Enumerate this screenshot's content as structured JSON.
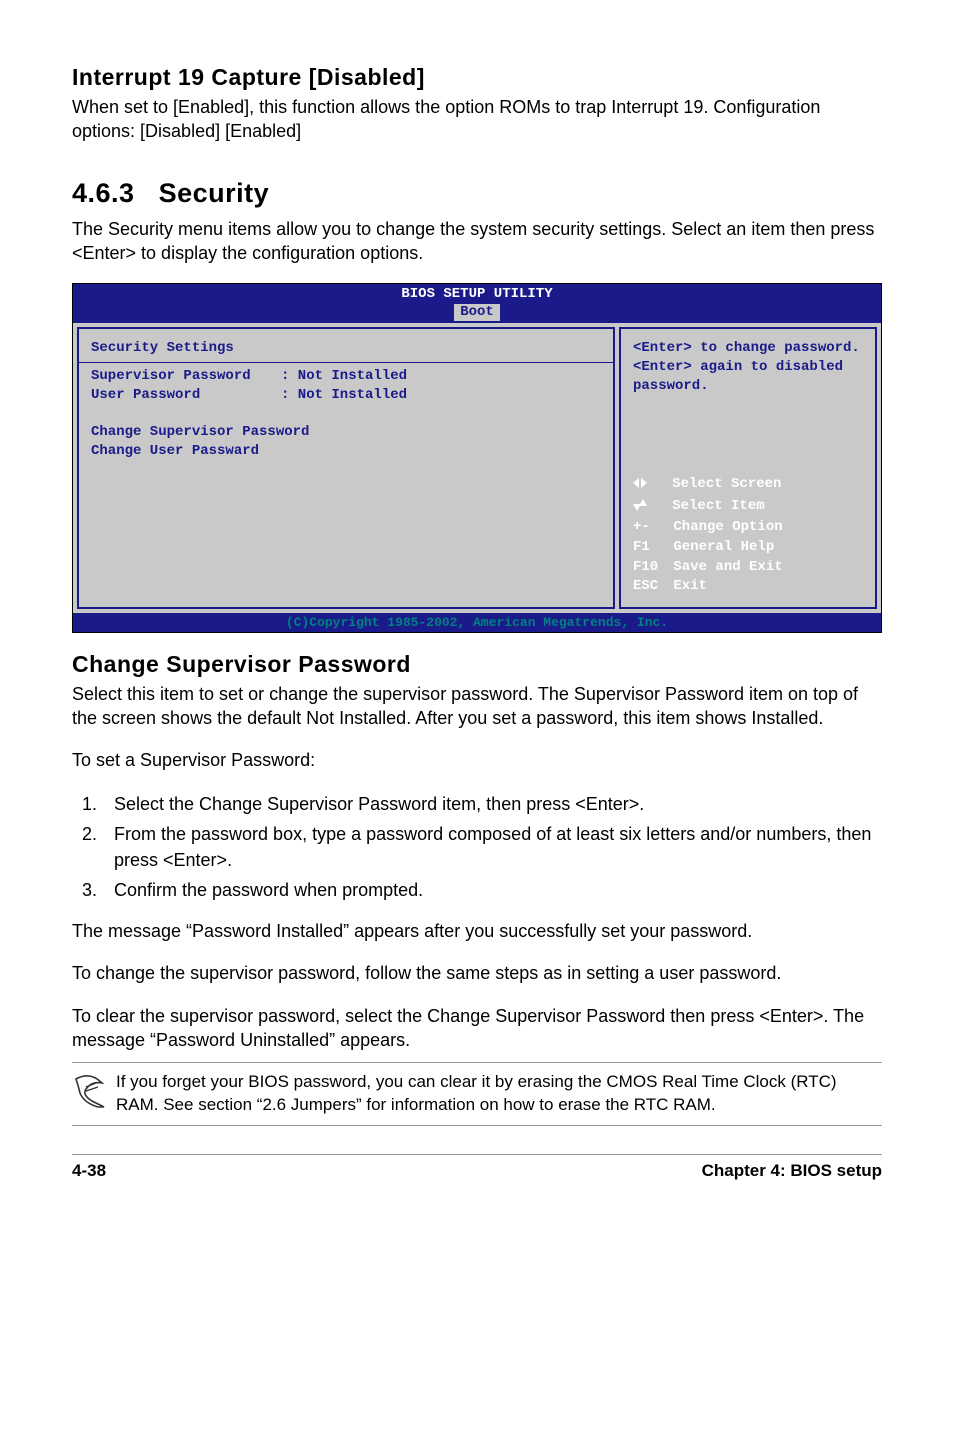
{
  "section_interrupt": {
    "title": "Interrupt 19 Capture [Disabled]",
    "body": "When set to [Enabled], this function allows the option ROMs to trap Interrupt 19. Configuration options: [Disabled] [Enabled]"
  },
  "section_security": {
    "number": "4.6.3",
    "title": "Security",
    "intro": "The Security menu items allow you to change the system security settings. Select an item then press <Enter> to display the configuration options."
  },
  "bios": {
    "header_title": "BIOS SETUP UTILITY",
    "tab": "Boot",
    "left": {
      "heading": "Security Settings",
      "rows": [
        {
          "label": "Supervisor Password",
          "value": ": Not Installed"
        },
        {
          "label": "User Password",
          "value": ": Not Installed"
        }
      ],
      "actions": [
        "Change Supervisor Password",
        "Change User Passward"
      ]
    },
    "right": {
      "help_text": "<Enter> to change password.\n<Enter> again to disabled password.",
      "keys": [
        {
          "key": "←→",
          "action": "Select Screen"
        },
        {
          "key": "↑↓",
          "action": "Select Item"
        },
        {
          "key": "+-",
          "action": "Change Option"
        },
        {
          "key": "F1",
          "action": "General Help"
        },
        {
          "key": "F10",
          "action": "Save and Exit"
        },
        {
          "key": "ESC",
          "action": "Exit"
        }
      ]
    },
    "copyright": "(C)Copyright 1985-2002, American Megatrends, Inc."
  },
  "change_supervisor": {
    "title": "Change Supervisor Password",
    "p1": "Select this item to set or change the supervisor password. The Supervisor Password item on top of the screen shows the default Not Installed. After you set a password, this item shows Installed.",
    "p2": "To set a Supervisor Password:",
    "steps": [
      "Select the Change Supervisor Password item, then press <Enter>.",
      "From the password box, type a password composed of at least six letters and/or numbers, then press <Enter>.",
      "Confirm the password when prompted."
    ],
    "p3": "The message “Password Installed” appears after you successfully set your password.",
    "p4": "To change the supervisor password, follow the same steps as in setting a user password.",
    "p5": "To clear the supervisor password, select the Change Supervisor Password then press <Enter>. The message “Password Uninstalled” appears."
  },
  "note": {
    "text": "If you forget your BIOS password, you can clear it by erasing the CMOS Real Time Clock (RTC) RAM. See section “2.6  Jumpers” for information on how to erase the RTC RAM."
  },
  "footer": {
    "left": "4-38",
    "right": "Chapter 4: BIOS setup"
  }
}
